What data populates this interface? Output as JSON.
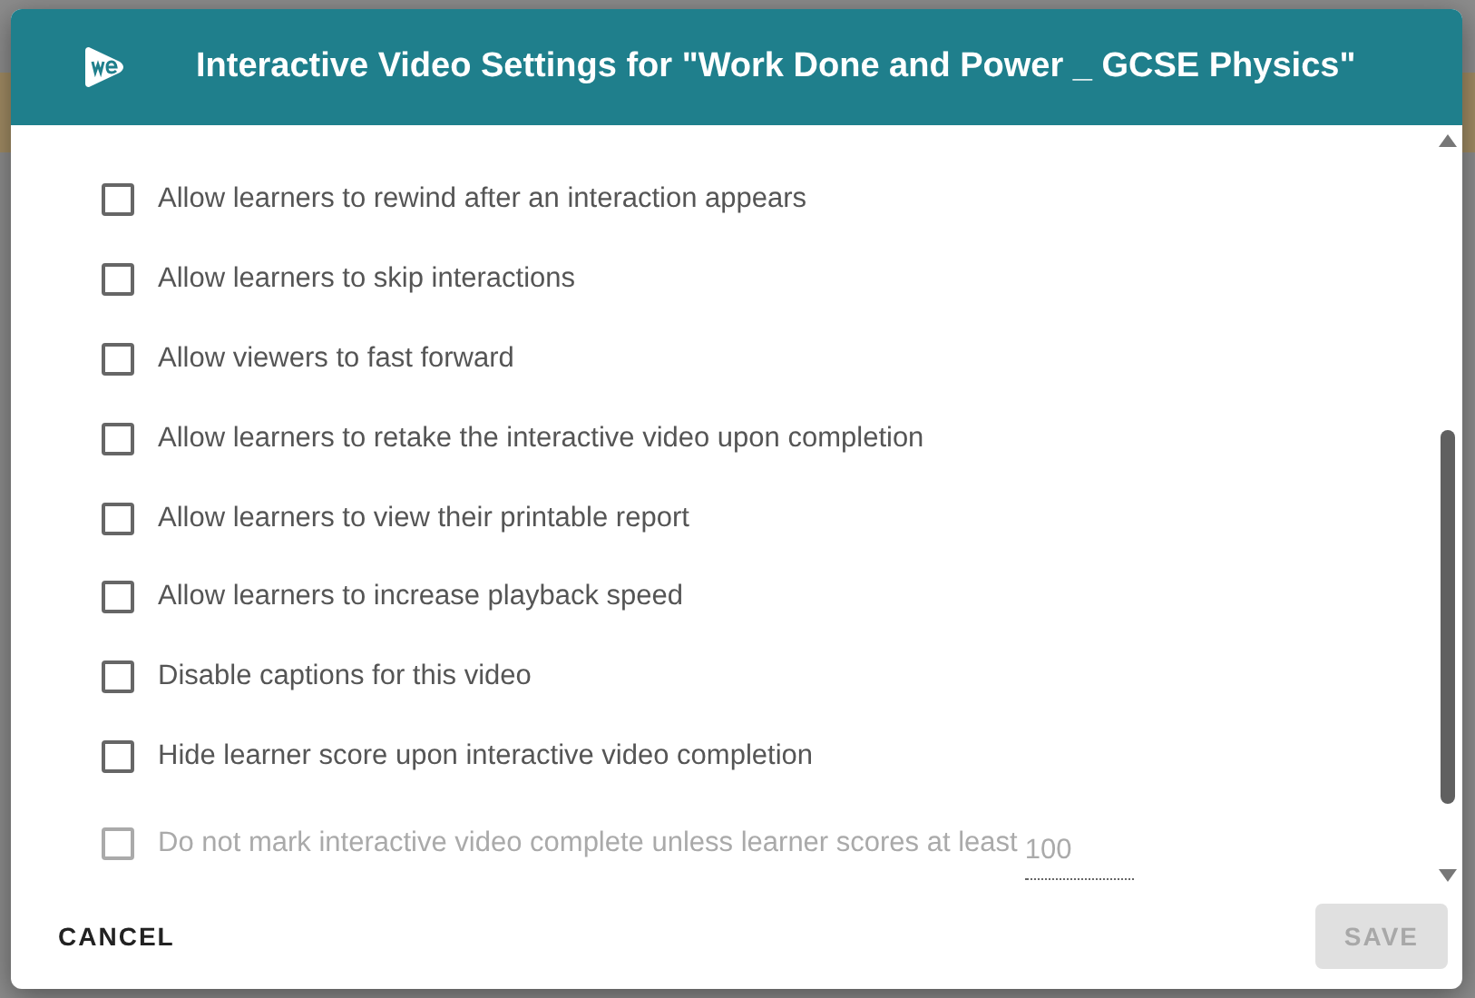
{
  "dialog": {
    "title": "Interactive Video Settings for \"Work Done and Power _ GCSE Physics\""
  },
  "options": [
    {
      "label": "Allow learners to rewind after an interaction appears",
      "checked": false,
      "disabled": false
    },
    {
      "label": "Allow learners to skip interactions",
      "checked": false,
      "disabled": false
    },
    {
      "label": "Allow viewers to fast forward",
      "checked": false,
      "disabled": false
    },
    {
      "label": "Allow learners to retake the interactive video upon completion",
      "checked": false,
      "disabled": false
    },
    {
      "label": "Allow learners to view their printable report",
      "checked": false,
      "disabled": false
    },
    {
      "label": "Allow learners to increase playback speed",
      "checked": false,
      "disabled": false
    },
    {
      "label": "Disable captions for this video",
      "checked": false,
      "disabled": false
    },
    {
      "label": "Hide learner score upon interactive video completion",
      "checked": false,
      "disabled": false
    },
    {
      "label": "Do not mark interactive video complete unless learner scores at least",
      "checked": false,
      "disabled": true,
      "field_value": "100"
    }
  ],
  "buttons": [
    {
      "label": "CANCEL",
      "disabled": false
    },
    {
      "label": "SAVE",
      "disabled": true
    }
  ]
}
